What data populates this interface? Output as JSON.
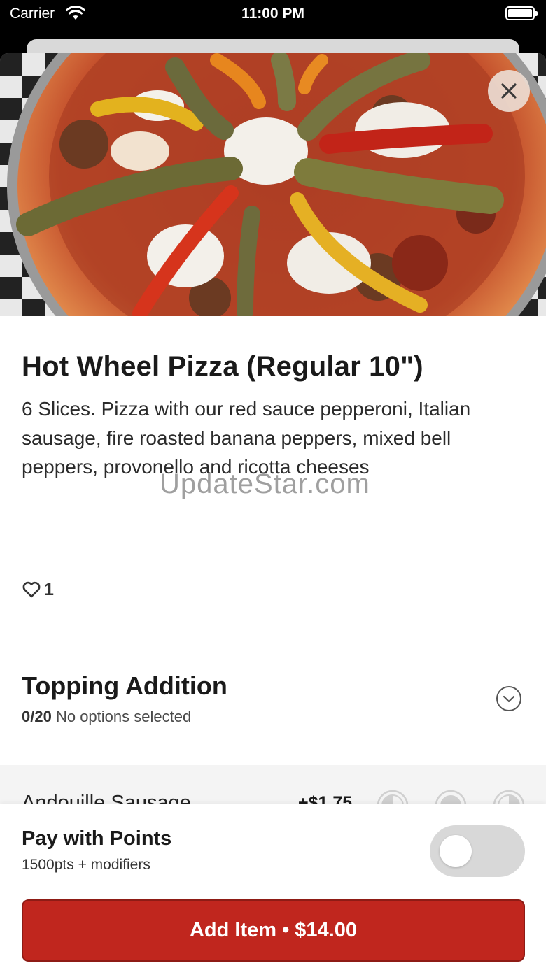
{
  "status_bar": {
    "carrier": "Carrier",
    "time": "11:00 PM"
  },
  "item": {
    "title": "Hot Wheel Pizza (Regular 10\")",
    "description": "6 Slices. Pizza with our red sauce pepperoni, Italian sausage, fire roasted banana peppers, mixed bell peppers, provonello and ricotta cheeses",
    "likes": "1",
    "watermark": "UpdateStar.com"
  },
  "modifier_group": {
    "title": "Topping Addition",
    "count": "0/20",
    "status": "No options selected",
    "options": [
      {
        "name": "Andouille Sausage",
        "price": "+$1.75"
      }
    ]
  },
  "points": {
    "title": "Pay with Points",
    "subtitle": "1500pts + modifiers",
    "enabled": false
  },
  "cta": {
    "label": "Add Item • $14.00"
  },
  "colors": {
    "primary": "#c0261e",
    "toggle_off": "#d8d8d8",
    "row_bg": "#f4f4f4"
  },
  "icons": {
    "close": "close-icon",
    "heart": "heart-icon",
    "chevron": "chevron-down-icon",
    "left_half": "left-half-icon",
    "whole": "whole-icon",
    "right_half": "right-half-icon"
  }
}
